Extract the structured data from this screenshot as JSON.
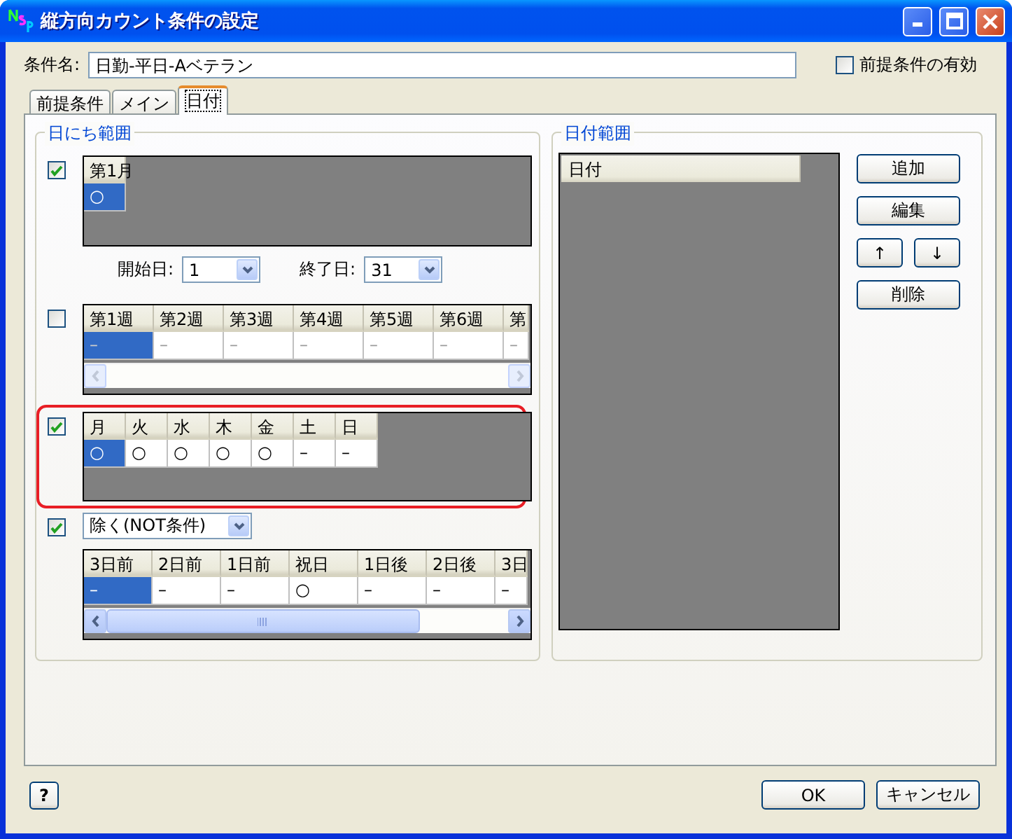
{
  "window": {
    "title": "縦方向カウント条件の設定"
  },
  "condition_name": {
    "label": "条件名:",
    "value": "日勤-平日-Aベテラン"
  },
  "prerequisite_enabled": {
    "label": "前提条件の有効",
    "checked": false
  },
  "tabs": [
    {
      "label": "前提条件",
      "selected": false
    },
    {
      "label": "メイン",
      "selected": false
    },
    {
      "label": "日付",
      "selected": true
    }
  ],
  "day_range": {
    "title": "日にち範囲",
    "sections": [
      {
        "checked": true,
        "highlighted": false,
        "grid": {
          "columns": [
            "第1月"
          ],
          "cells": [
            {
              "text": "○",
              "selected": true
            }
          ]
        },
        "start": {
          "label": "開始日:",
          "value": "1"
        },
        "end": {
          "label": "終了日:",
          "value": "31"
        }
      },
      {
        "checked": false,
        "highlighted": false,
        "grid": {
          "columns": [
            "第1週",
            "第2週",
            "第3週",
            "第4週",
            "第5週",
            "第6週",
            "第"
          ],
          "cells": [
            {
              "text": "–",
              "selected": true
            },
            {
              "text": "–",
              "selected": false
            },
            {
              "text": "–",
              "selected": false
            },
            {
              "text": "–",
              "selected": false
            },
            {
              "text": "–",
              "selected": false
            },
            {
              "text": "–",
              "selected": false
            },
            {
              "text": "–",
              "selected": false
            }
          ],
          "scrollbar": {
            "disabled": true
          }
        }
      },
      {
        "checked": true,
        "highlighted": true,
        "grid": {
          "columns": [
            "月",
            "火",
            "水",
            "木",
            "金",
            "土",
            "日"
          ],
          "cells": [
            {
              "text": "○",
              "selected": true
            },
            {
              "text": "○",
              "selected": false
            },
            {
              "text": "○",
              "selected": false
            },
            {
              "text": "○",
              "selected": false
            },
            {
              "text": "○",
              "selected": false
            },
            {
              "text": "–",
              "selected": false
            },
            {
              "text": "–",
              "selected": false
            }
          ]
        }
      },
      {
        "checked": true,
        "highlighted": false,
        "filter": {
          "value": "除く(NOT条件)"
        },
        "grid": {
          "columns": [
            "3日前",
            "2日前",
            "1日前",
            "祝日",
            "1日後",
            "2日後",
            "3日"
          ],
          "cells": [
            {
              "text": "–",
              "selected": true
            },
            {
              "text": "–",
              "selected": false
            },
            {
              "text": "–",
              "selected": false
            },
            {
              "text": "○",
              "selected": false
            },
            {
              "text": "–",
              "selected": false
            },
            {
              "text": "–",
              "selected": false
            },
            {
              "text": "–",
              "selected": false
            }
          ],
          "scrollbar": {
            "disabled": false
          }
        }
      }
    ]
  },
  "date_range": {
    "title": "日付範囲",
    "list_header": "日付",
    "buttons": [
      {
        "label": "追加",
        "kind": "wide"
      },
      {
        "label": "編集",
        "kind": "wide"
      },
      {
        "label": "↑",
        "kind": "half"
      },
      {
        "label": "↓",
        "kind": "half"
      },
      {
        "label": "削除",
        "kind": "wide"
      }
    ]
  },
  "help_button": "?",
  "ok_button": "OK",
  "cancel_button": "キャンセル"
}
